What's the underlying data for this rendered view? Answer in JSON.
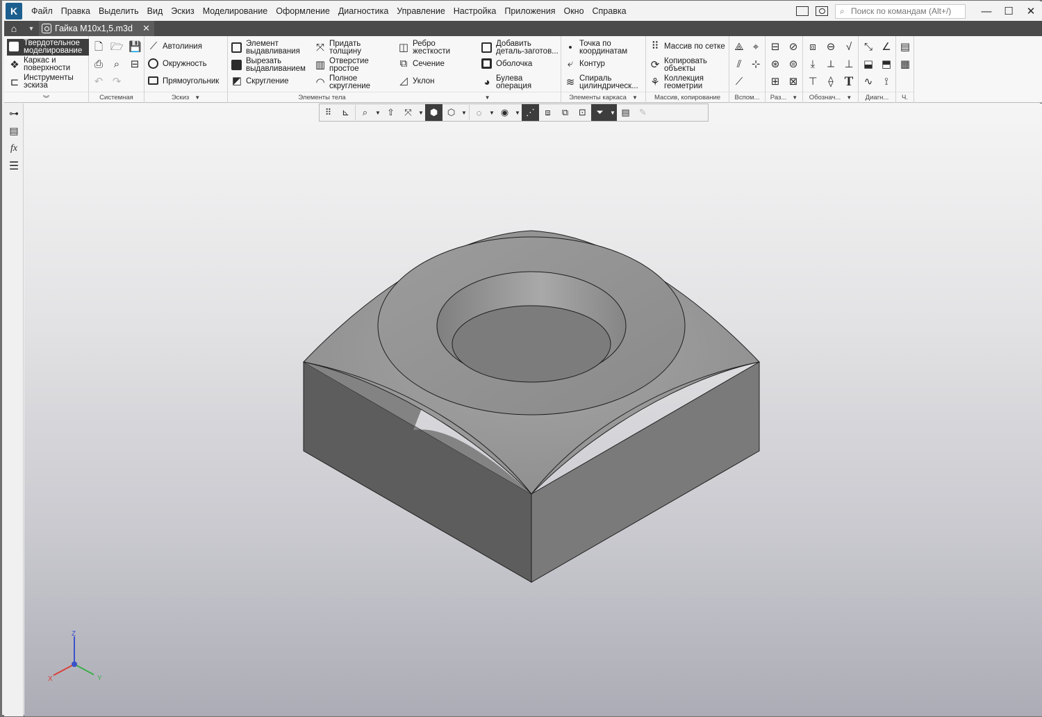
{
  "app": {
    "menu": [
      "Файл",
      "Правка",
      "Выделить",
      "Вид",
      "Эскиз",
      "Моделирование",
      "Оформление",
      "Диагностика",
      "Управление",
      "Настройка",
      "Приложения",
      "Окно",
      "Справка"
    ],
    "search_placeholder": "Поиск по командам (Alt+/)",
    "window_controls": {
      "minimize": "—",
      "maximize": "☐",
      "close": "✕"
    }
  },
  "tabs": {
    "active_document": "Гайка М10х1,5.m3d",
    "close_glyph": "✕"
  },
  "ribbon": {
    "modes": [
      {
        "label": "Твердотельное моделирование",
        "active": true,
        "icon": "solid-cube-icon"
      },
      {
        "label": "Каркас и поверхности",
        "active": false,
        "icon": "surfaces-icon"
      },
      {
        "label": "Инструменты эскиза",
        "active": false,
        "icon": "sketch-tools-icon"
      }
    ],
    "groups": {
      "system": {
        "label": "Системная"
      },
      "sketch": {
        "label": "Эскиз",
        "buttons": [
          "Автолиния",
          "Окружность",
          "Прямоугольник"
        ]
      },
      "body": {
        "label": "Элементы тела",
        "buttons": [
          "Элемент выдавливания",
          "Вырезать выдавливанием",
          "Скругление",
          "Придать толщину",
          "Отверстие простое",
          "Полное скругление",
          "Ребро жесткости",
          "Сечение",
          "Уклон",
          "Добавить деталь-заготов...",
          "Оболочка",
          "Булева операция"
        ]
      },
      "frame": {
        "label": "Элементы каркаса",
        "buttons": [
          "Точка по координатам",
          "Контур",
          "Спираль цилиндрическ..."
        ]
      },
      "array": {
        "label": "Массив, копирование",
        "buttons": [
          "Массив по сетке",
          "Копировать объекты",
          "Коллекция геометрии"
        ]
      },
      "aux": {
        "label": "Вспом..."
      },
      "dims": {
        "label": "Раз..."
      },
      "notes": {
        "label": "Обознач..."
      },
      "diag": {
        "label": "Диагн..."
      },
      "misc": {
        "label": "Ч."
      }
    },
    "collapse_glyph": "︾",
    "text_tool_glyph": "T"
  },
  "left_tools": [
    "tree-icon",
    "properties-icon",
    "variables-icon",
    "layers-icon"
  ],
  "left_fx": "fx",
  "triad": {
    "x": "X",
    "y": "Y",
    "z": "Z"
  },
  "colors": {
    "accent_dark": "#3d3d3d",
    "tab_bar": "#4a4a4a",
    "axis_x": "#d9423a",
    "axis_y": "#3cae4a",
    "axis_z": "#3a52c9"
  }
}
